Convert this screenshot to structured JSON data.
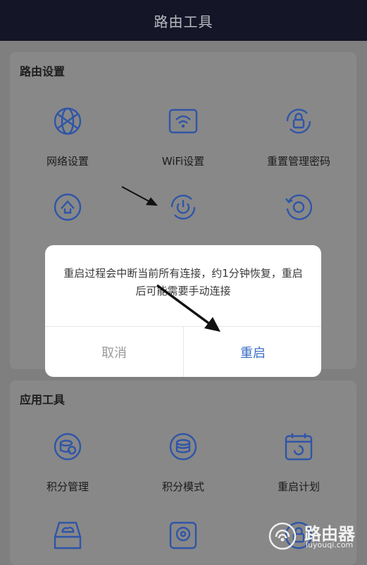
{
  "header": {
    "title": "路由工具"
  },
  "router_section": {
    "title": "路由设置",
    "items": [
      {
        "label": "网络设置",
        "icon": "globe-icon"
      },
      {
        "label": "WiFi设置",
        "icon": "wifi-router-icon"
      },
      {
        "label": "重置管理密码",
        "icon": "lock-reset-icon"
      },
      {
        "label": "",
        "icon": "upgrade-icon"
      },
      {
        "label": "",
        "icon": "restart-icon"
      },
      {
        "label": "",
        "icon": "reset-icon"
      }
    ]
  },
  "app_section": {
    "title": "应用工具",
    "items": [
      {
        "label": "积分管理",
        "icon": "points-management-icon"
      },
      {
        "label": "积分模式",
        "icon": "points-mode-icon"
      },
      {
        "label": "重启计划",
        "icon": "restart-schedule-icon"
      },
      {
        "label": "",
        "icon": "cloud-storage-icon"
      },
      {
        "label": "",
        "icon": "location-icon"
      },
      {
        "label": "",
        "icon": "lock-icon"
      }
    ]
  },
  "dialog": {
    "message": "重启过程会中断当前所有连接，约1分钟恢复，重启后可能需要手动连接",
    "cancel_label": "取消",
    "confirm_label": "重启"
  },
  "watermark": {
    "brand": "路由器",
    "site": "luyouqi.com"
  },
  "colors": {
    "accent": "#3a6fc4",
    "icon": "#2f55a8",
    "header_bg": "#141628"
  }
}
